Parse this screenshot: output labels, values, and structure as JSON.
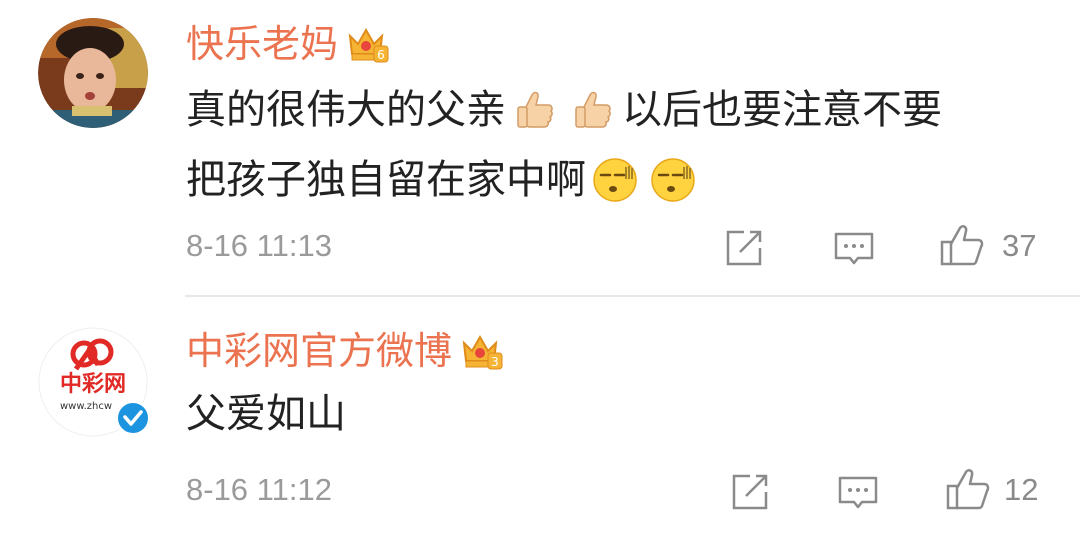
{
  "comments": [
    {
      "username": "快乐老妈",
      "member_level": "6",
      "content_parts": [
        "真的很伟大的父亲",
        "以后也要注意不要",
        "把孩子独自留在家中啊"
      ],
      "emojis": [
        "thumbs-up",
        "thumbs-up",
        "awkward-face",
        "awkward-face"
      ],
      "time": "8-16 11:13",
      "likes": "37"
    },
    {
      "username": "中彩网官方微博",
      "member_level": "3",
      "content": "父爱如山",
      "avatar_text": "中彩网",
      "avatar_url_text": "www.zhcw",
      "verified": true,
      "time": "8-16 11:12",
      "likes": "12"
    }
  ],
  "colors": {
    "username": "#eb7350",
    "text": "#222222",
    "meta": "#9a9a9a",
    "icon": "#8a8a8a",
    "divider": "#e8e8e8",
    "verified_badge": "#1c94e0"
  }
}
